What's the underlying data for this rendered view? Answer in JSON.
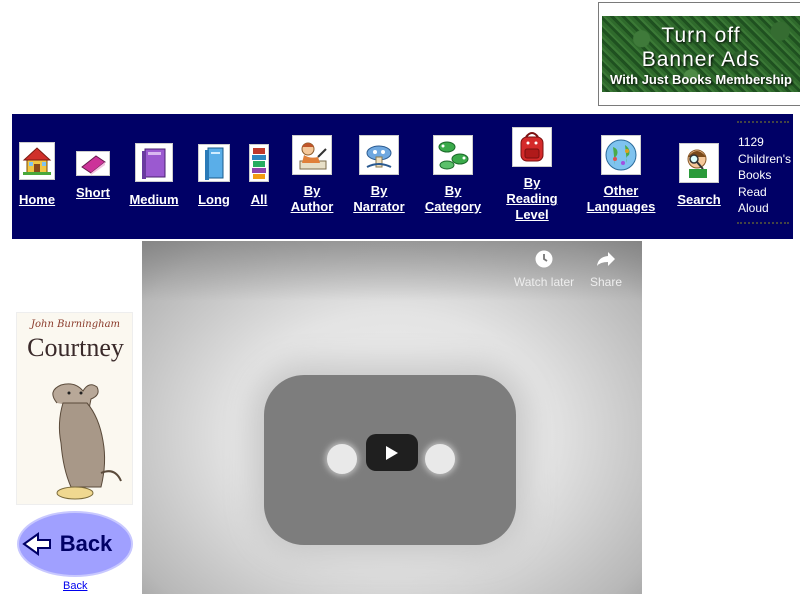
{
  "banner": {
    "line1": "Turn off",
    "line2": "Banner Ads",
    "line3": "With Just Books Membership"
  },
  "nav": {
    "items": [
      {
        "id": "home",
        "label_lines": [
          "Home"
        ],
        "icon": "house-icon"
      },
      {
        "id": "short",
        "label_lines": [
          "Short"
        ],
        "icon": "book-small-icon"
      },
      {
        "id": "medium",
        "label_lines": [
          "Medium"
        ],
        "icon": "book-medium-icon"
      },
      {
        "id": "long",
        "label_lines": [
          "Long"
        ],
        "icon": "book-long-icon"
      },
      {
        "id": "all",
        "label_lines": [
          "All"
        ],
        "icon": "book-stack-icon"
      },
      {
        "id": "by-author",
        "label_lines": [
          "By",
          "Author"
        ],
        "icon": "author-icon"
      },
      {
        "id": "by-narrator",
        "label_lines": [
          "By",
          "Narrator"
        ],
        "icon": "narrator-icon"
      },
      {
        "id": "by-category",
        "label_lines": [
          "By",
          "Category"
        ],
        "icon": "category-icon"
      },
      {
        "id": "by-reading-level",
        "label_lines": [
          "By",
          "Reading",
          "Level"
        ],
        "icon": "backpack-icon"
      },
      {
        "id": "other-languages",
        "label_lines": [
          "Other",
          "Languages"
        ],
        "icon": "globe-icon"
      },
      {
        "id": "search",
        "label_lines": [
          "Search"
        ],
        "icon": "magnifier-kid-icon"
      }
    ],
    "count_lines": [
      "1129",
      "Children's",
      "Books",
      "Read",
      "Aloud"
    ]
  },
  "book": {
    "author": "John Burningham",
    "title": "Courtney"
  },
  "back": {
    "button_label": "Back",
    "link_label": "Back"
  },
  "video": {
    "watch_later_label": "Watch later",
    "share_label": "Share"
  },
  "colors": {
    "nav_background": "#000066",
    "nav_text": "#ffffff",
    "link": "#0000ee",
    "back_button": "#9999ff"
  }
}
